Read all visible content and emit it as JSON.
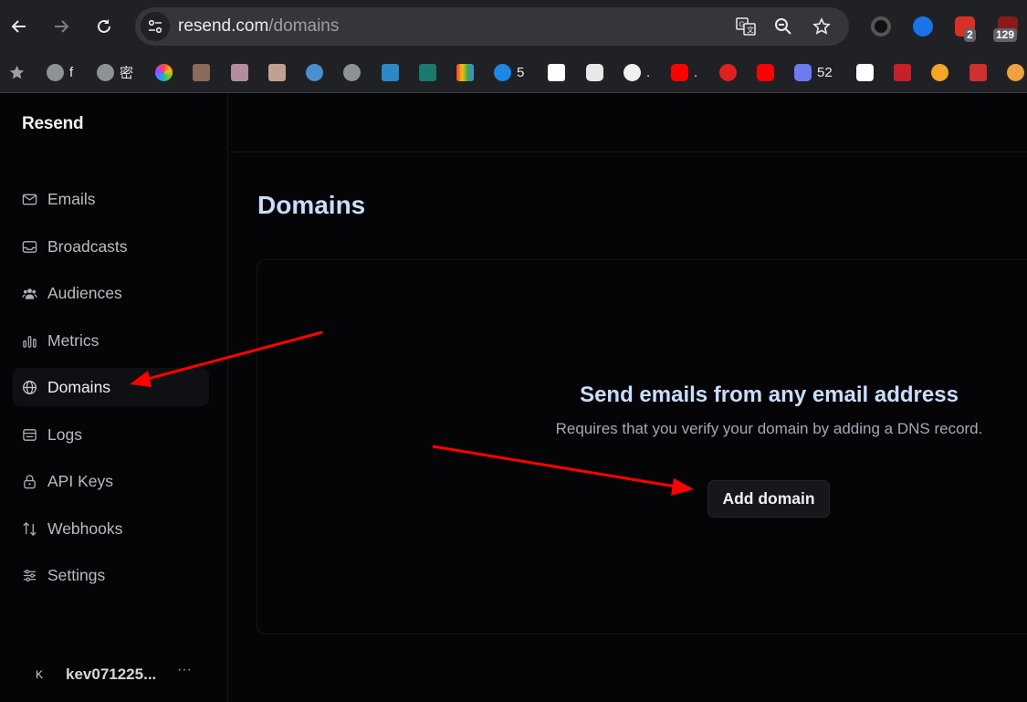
{
  "browser": {
    "url_host": "resend.com",
    "url_path": "/domains",
    "extension_badges": [
      "2",
      "129"
    ],
    "bookmarks": [
      {
        "label": "",
        "icon": "star-icon"
      },
      {
        "label": "f",
        "icon": "globe-icon"
      },
      {
        "label": "密",
        "icon": "globe-icon"
      },
      {
        "label": "",
        "icon": "photos-icon"
      },
      {
        "label": "",
        "icon": "avatar-icon"
      },
      {
        "label": "",
        "icon": "avatar-icon"
      },
      {
        "label": "",
        "icon": "avatar-icon"
      },
      {
        "label": "",
        "icon": "ball-icon"
      },
      {
        "label": "",
        "icon": "globe-icon"
      },
      {
        "label": "",
        "icon": "hux-icon"
      },
      {
        "label": "",
        "icon": "logo-icon"
      },
      {
        "label": "",
        "icon": "gmail-icon"
      },
      {
        "label": "5",
        "icon": "onedrive-icon"
      },
      {
        "label": "",
        "icon": "logo-icon"
      },
      {
        "label": "",
        "icon": "openai-icon"
      },
      {
        "label": ".",
        "icon": "github-icon"
      },
      {
        "label": ".",
        "icon": "youtube-icon"
      },
      {
        "label": "",
        "icon": "logo-icon"
      },
      {
        "label": "",
        "icon": "youtube-icon"
      },
      {
        "label": "52",
        "icon": "logo-icon"
      },
      {
        "label": "",
        "icon": "baidu-drive-icon"
      },
      {
        "label": "",
        "icon": "stamp-icon"
      },
      {
        "label": "",
        "icon": "logo-icon"
      },
      {
        "label": "",
        "icon": "logo-icon"
      },
      {
        "label": "",
        "icon": "logo-icon"
      }
    ]
  },
  "app": {
    "brand": "Resend",
    "nav": [
      {
        "label": "Emails",
        "icon": "mail-icon"
      },
      {
        "label": "Broadcasts",
        "icon": "inbox-icon"
      },
      {
        "label": "Audiences",
        "icon": "users-icon"
      },
      {
        "label": "Metrics",
        "icon": "bar-chart-icon"
      },
      {
        "label": "Domains",
        "icon": "globe-icon",
        "active": true
      },
      {
        "label": "Logs",
        "icon": "logs-icon"
      },
      {
        "label": "API Keys",
        "icon": "lock-icon"
      },
      {
        "label": "Webhooks",
        "icon": "arrows-icon"
      },
      {
        "label": "Settings",
        "icon": "sliders-icon"
      }
    ],
    "user": {
      "initial": "K",
      "name": "kev071225...",
      "more": "···"
    },
    "page_title": "Domains",
    "empty_state": {
      "title": "Send emails from any email address",
      "subtitle": "Requires that you verify your domain by adding a DNS record.",
      "button": "Add domain"
    }
  },
  "colors": {
    "accent_title": "#c8defa",
    "annotation_arrow": "#ff0000"
  }
}
